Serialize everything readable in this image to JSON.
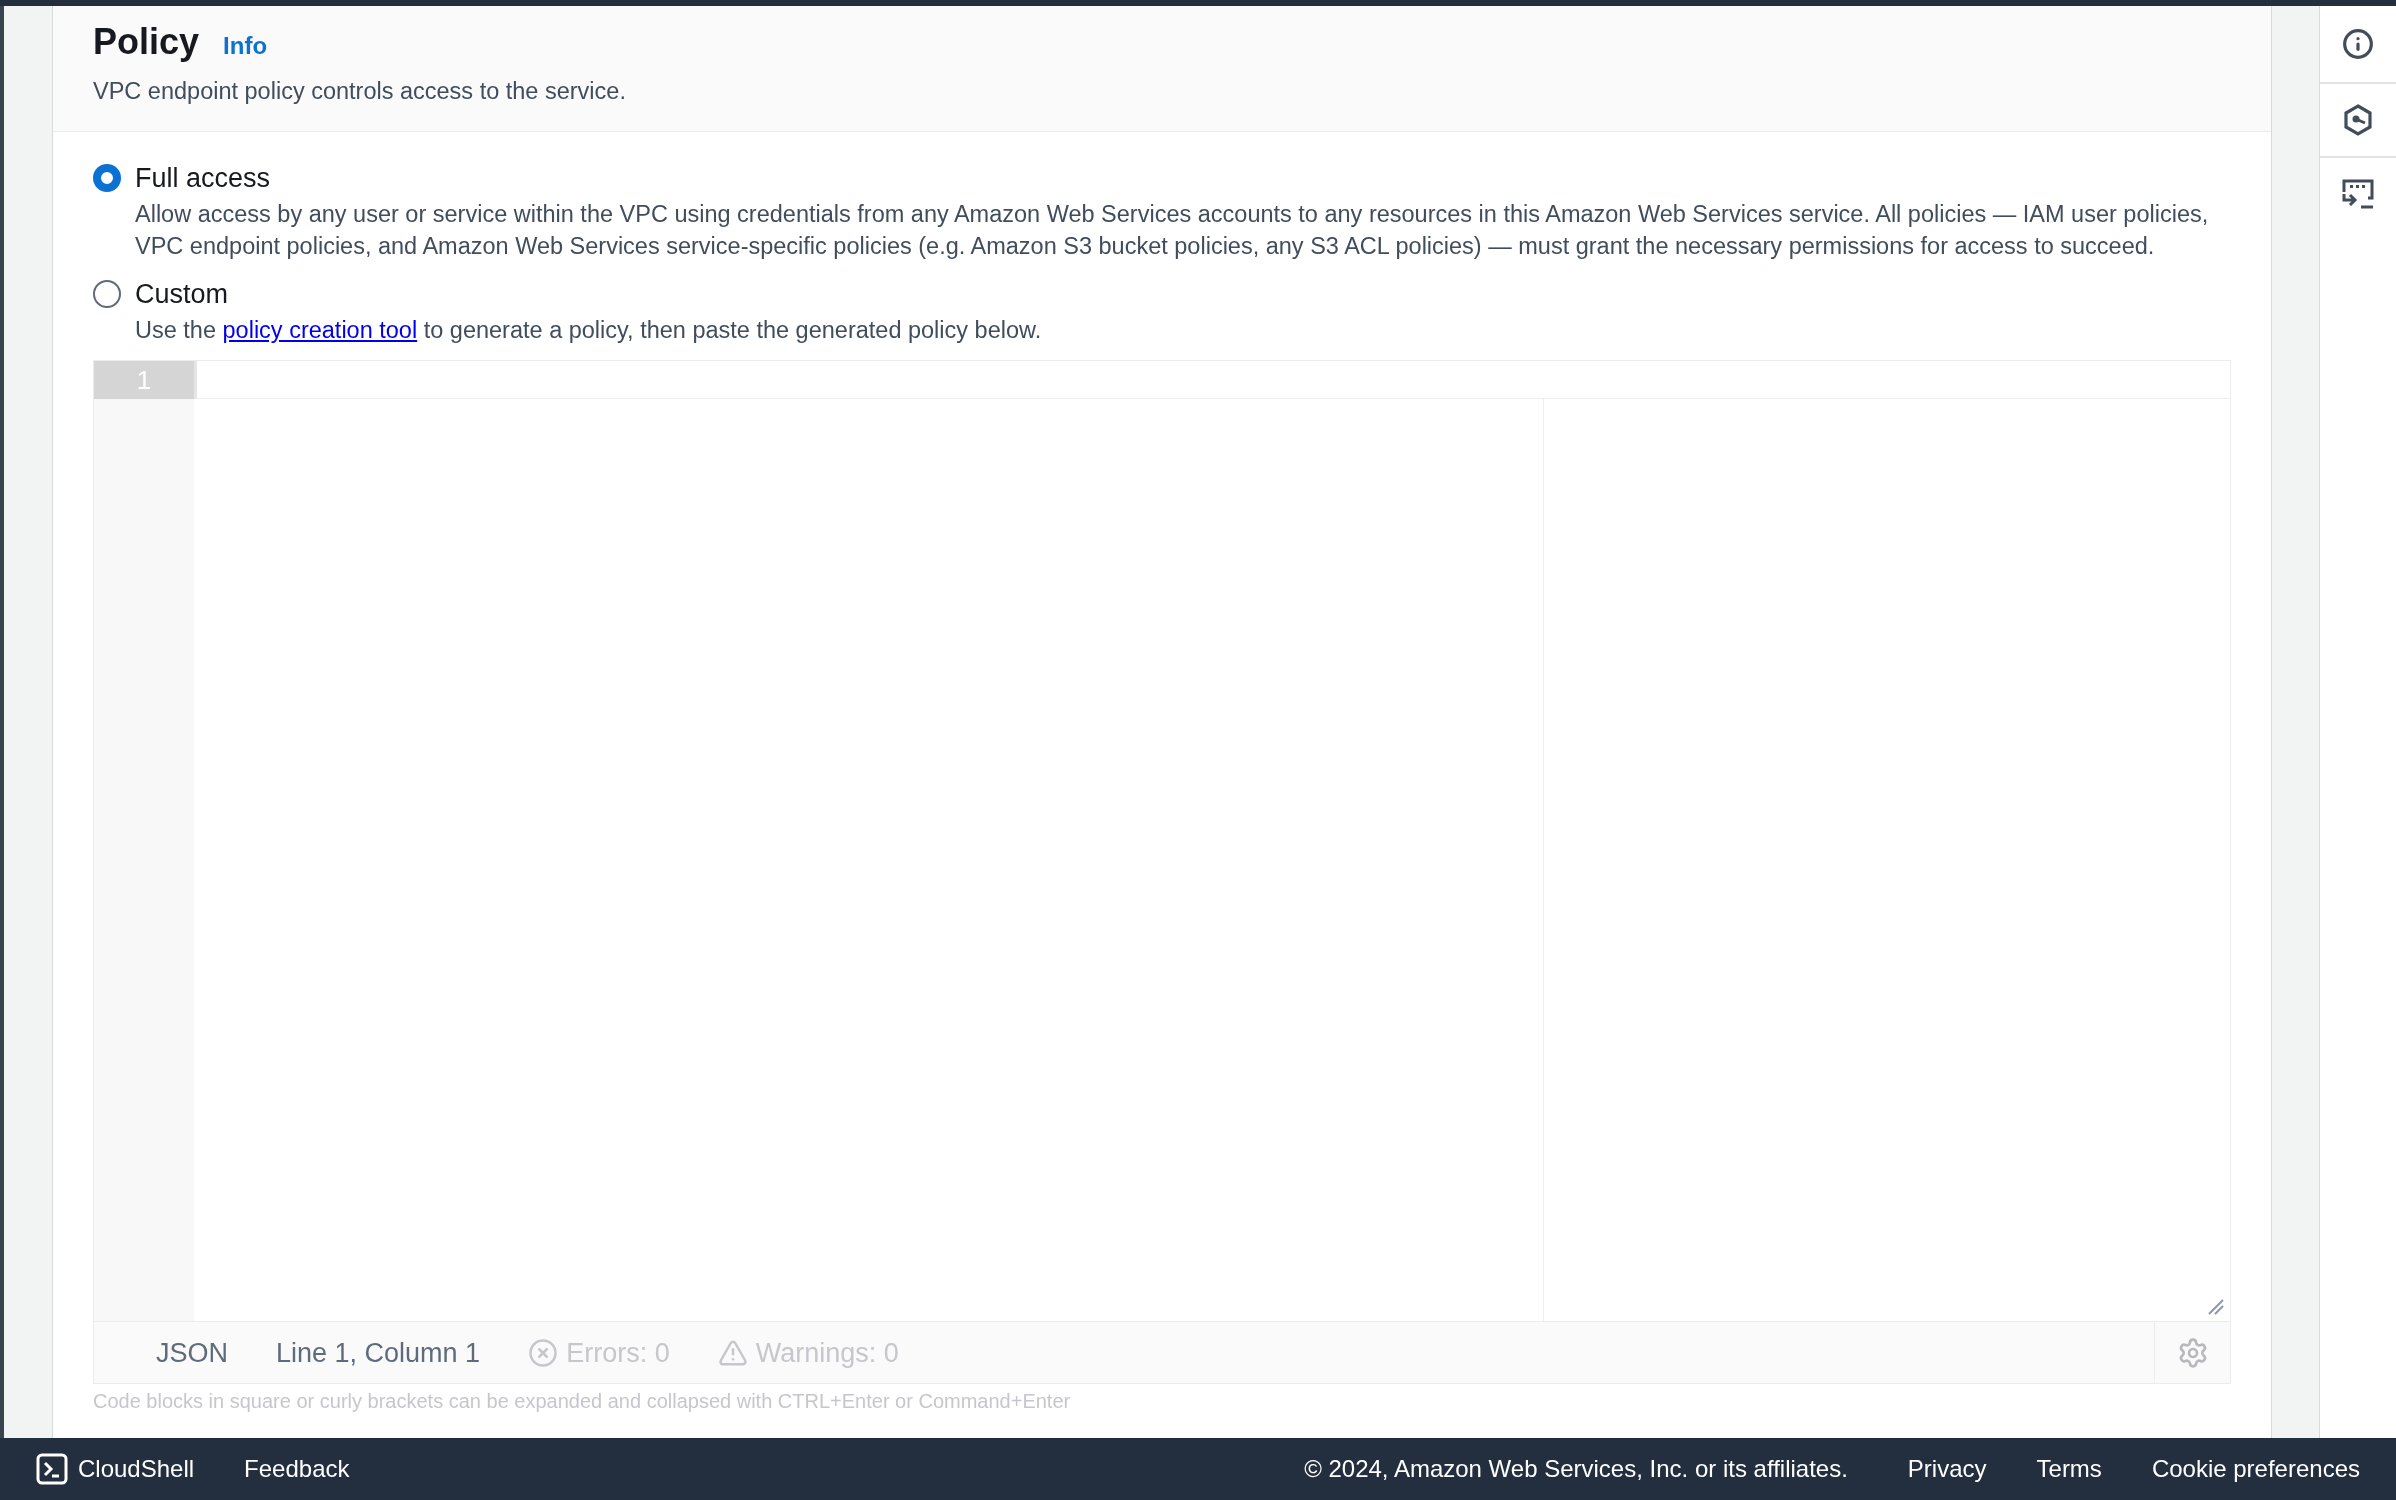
{
  "section": {
    "title": "Policy",
    "info_link": "Info",
    "description": "VPC endpoint policy controls access to the service."
  },
  "options": [
    {
      "label": "Full access",
      "selected": true,
      "description": "Allow access by any user or service within the VPC using credentials from any Amazon Web Services accounts to any resources in this Amazon Web Services service. All policies — IAM user policies, VPC endpoint policies, and Amazon Web Services service-specific policies (e.g. Amazon S3 bucket policies, any S3 ACL policies) — must grant the necessary permissions for access to succeed."
    },
    {
      "label": "Custom",
      "selected": false,
      "description_before": "Use the",
      "description_link": "policy creation tool",
      "description_after": "to generate a policy, then paste the generated policy below."
    }
  ],
  "editor": {
    "line_numbers": [
      "1"
    ],
    "status": {
      "mode": "JSON",
      "cursor": "Line 1, Column 1",
      "errors": "Errors: 0",
      "warnings": "Warnings: 0"
    },
    "hint": "Code blocks in square or curly brackets can be expanded and collapsed with CTRL+Enter or Command+Enter"
  },
  "footer": {
    "cloudshell": "CloudShell",
    "feedback": "Feedback",
    "copyright": "© 2024, Amazon Web Services, Inc. or its affiliates.",
    "links": [
      "Privacy",
      "Terms",
      "Cookie preferences"
    ]
  }
}
